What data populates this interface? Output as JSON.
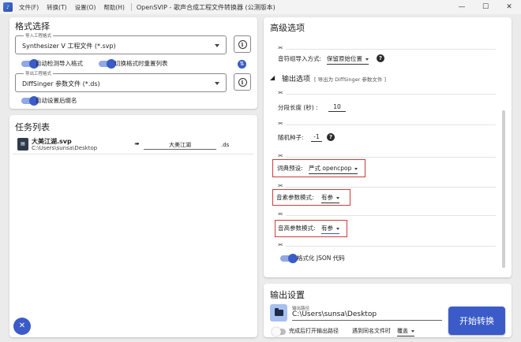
{
  "titlebar": {
    "menu": [
      "文件(F)",
      "转换(T)",
      "设置(O)",
      "帮助(H)"
    ],
    "title": "OpenSVIP - 歌声合成工程文件转换器 (公测版本)"
  },
  "format": {
    "heading": "格式选择",
    "import_label": "导入工程格式",
    "import_value": "Synthesizer V 工程文件 (*.svp)",
    "export_label": "导出工程格式",
    "export_value": "DiffSinger 参数文件 (*.ds)",
    "auto_detect": "自动检测导入格式",
    "reset_list": "切换格式时重置列表",
    "auto_rename": "自动设置后缀名"
  },
  "tasks": {
    "heading": "任务列表",
    "items": [
      {
        "name": "大美江湖.svp",
        "path": "C:\\Users\\sunsa\\Desktop",
        "output_name": "大美江湖",
        "ext": ".ds"
      }
    ]
  },
  "advanced": {
    "heading": "高级选项",
    "note_import_label": "音符组导入方式:",
    "note_import_value": "保留原始位置",
    "output_section": "输出选项",
    "output_section_note": "[ 导出为 DiffSinger 参数文件 ]",
    "segment_label": "分段长度 (秒) :",
    "segment_value": "10",
    "seed_label": "随机种子:",
    "seed_value": "-1",
    "dict_label": "词典预设:",
    "dict_value": "严式 opencpop",
    "phoneme_label": "音素参数模式:",
    "phoneme_value": "有参",
    "pitch_label": "音高参数模式:",
    "pitch_value": "有参",
    "json_format": "格式化 JSON 代码"
  },
  "output": {
    "heading": "输出设置",
    "path_label": "输出路径",
    "path_value": "C:\\Users\\sunsa\\Desktop",
    "open_after": "完成后打开输出路径",
    "conflict_label": "遇到同名文件时",
    "conflict_value": "覆盖",
    "convert_button": "开始转换"
  }
}
